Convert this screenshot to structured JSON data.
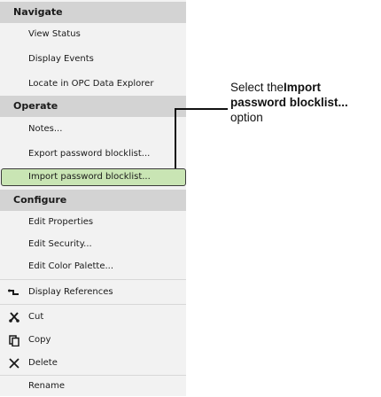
{
  "menu": {
    "navigate_header": "Navigate",
    "view_status": "View Status",
    "display_events": "Display Events",
    "locate_opc": "Locate in OPC Data Explorer",
    "operate_header": "Operate",
    "notes": "Notes...",
    "export_blocklist": "Export password blocklist...",
    "import_blocklist": "Import password blocklist...",
    "configure_header": "Configure",
    "edit_properties": "Edit Properties",
    "edit_security": "Edit Security...",
    "edit_color_palette": "Edit Color Palette...",
    "display_references": "Display References",
    "cut": "Cut",
    "copy": "Copy",
    "delete": "Delete",
    "rename": "Rename"
  },
  "icons": {
    "display_references": "references-icon",
    "cut": "scissors-icon",
    "copy": "copy-icon",
    "delete": "delete-x-icon"
  },
  "callout": {
    "text_prefix": "Select the ",
    "text_bold": "Import password blocklist...",
    "text_suffix": " option"
  },
  "colors": {
    "header_bg": "#d3d3d3",
    "menu_bg": "#f2f2f2",
    "highlight_bg": "#c9e5b4",
    "highlight_border": "#3b3b3b"
  }
}
